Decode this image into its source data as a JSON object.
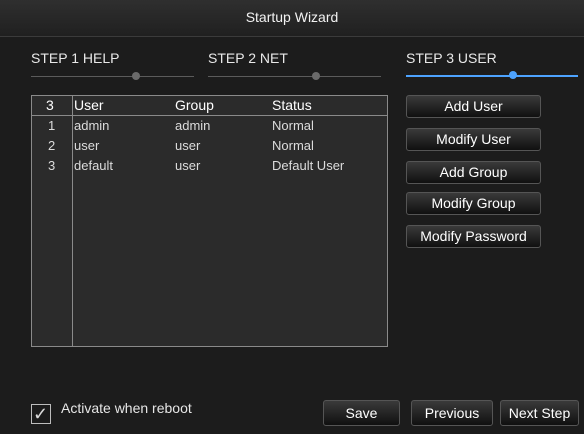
{
  "window": {
    "title": "Startup Wizard"
  },
  "steps": [
    {
      "label": "STEP 1 HELP"
    },
    {
      "label": "STEP 2 NET"
    },
    {
      "label": "STEP 3 USER"
    }
  ],
  "table": {
    "headers": [
      "3",
      "User",
      "Group",
      "Status"
    ],
    "rows": [
      [
        "1",
        "admin",
        "admin",
        "Normal"
      ],
      [
        "2",
        "user",
        "user",
        "Normal"
      ],
      [
        "3",
        "default",
        "user",
        "Default User"
      ]
    ]
  },
  "actions": {
    "add_user": "Add User",
    "modify_user": "Modify User",
    "add_group": "Add Group",
    "modify_group": "Modify Group",
    "modify_password": "Modify Password"
  },
  "footer": {
    "activate_label": "Activate when reboot",
    "save": "Save",
    "previous": "Previous",
    "next_step": "Next Step"
  },
  "colors": {
    "accent": "#4da3ff",
    "panel": "#2b2b2b"
  }
}
